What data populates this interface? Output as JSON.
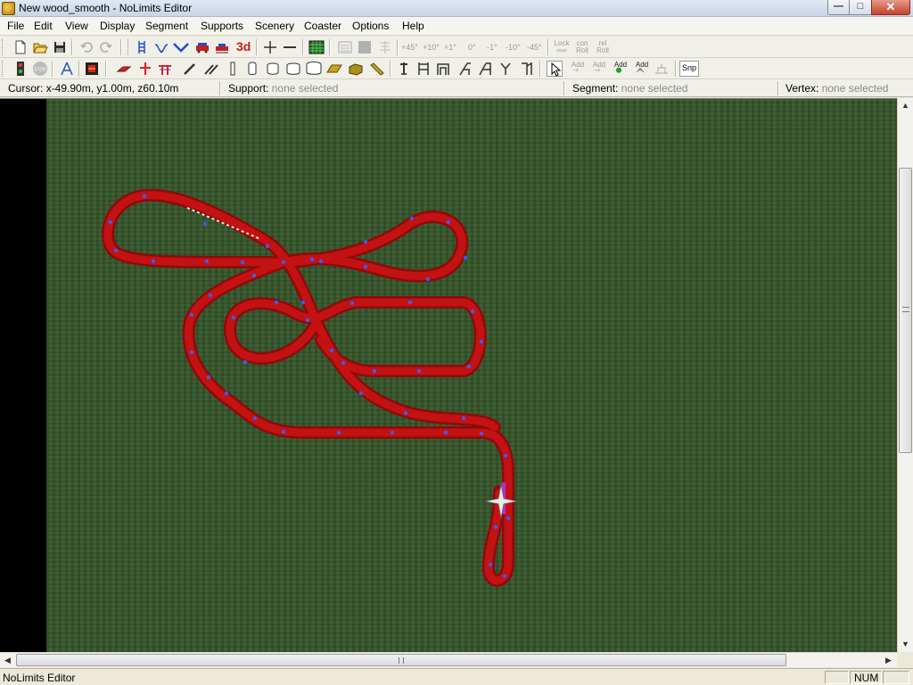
{
  "window": {
    "title": "New wood_smooth - NoLimits Editor",
    "buttons": {
      "minimize": "—",
      "maximize": "□",
      "close": "✕"
    }
  },
  "menu": [
    "File",
    "Edit",
    "View",
    "Display",
    "Segment",
    "Supports",
    "Scenery",
    "Coaster",
    "Options",
    "Help"
  ],
  "toolbar1": {
    "three_d_label": "3d",
    "angle_buttons": [
      "+45°",
      "+10°",
      "+1°",
      "0°",
      "-1°",
      "-10°",
      "-45°"
    ],
    "roll_buttons": [
      {
        "line1": "Lock",
        "line2": "∞∞"
      },
      {
        "line1": "con",
        "line2": "Roll"
      },
      {
        "line1": "rel",
        "line2": "Roll"
      }
    ]
  },
  "toolbar2": {
    "add_buttons": [
      {
        "line1": "Add",
        "line2": ""
      },
      {
        "line1": "Add",
        "line2": ""
      },
      {
        "line1": "Add",
        "line2": ""
      },
      {
        "line1": "Add",
        "line2": ""
      }
    ],
    "snap_label": "Snp"
  },
  "infobar": {
    "cursor_label": "Cursor:",
    "cursor_value": "x-49.90m, y1.00m, z60.10m",
    "support_label": "Support:",
    "support_value": "none selected",
    "segment_label": "Segment:",
    "segment_value": "none selected",
    "vertex_label": "Vertex:",
    "vertex_value": "none selected"
  },
  "colors": {
    "track": "#c31212",
    "track_dark": "#8f0a0a",
    "vertex": "#3a5cff",
    "ground": "#35562a"
  },
  "statusbar": {
    "message": "NoLimits Editor",
    "panes": [
      "",
      "NUM",
      ""
    ]
  },
  "icons": [
    "new-file-icon",
    "open-file-icon",
    "save-icon",
    "undo-icon",
    "redo-icon",
    "select-arrow-icon",
    "cursor-crosshair-icon"
  ]
}
